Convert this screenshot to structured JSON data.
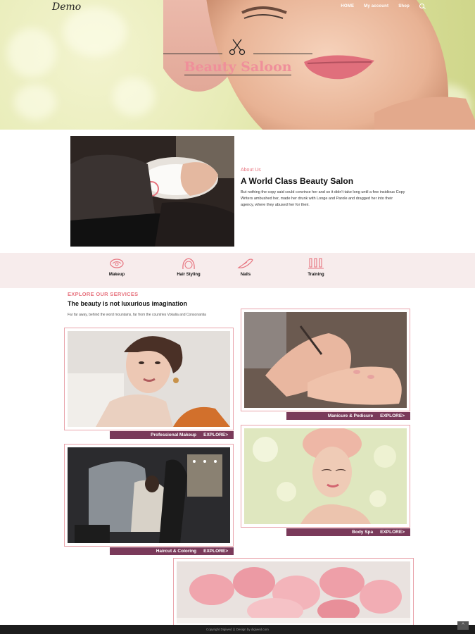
{
  "header": {
    "logo": "Demo",
    "nav": [
      "HOME",
      "My account",
      "Shop"
    ]
  },
  "hero": {
    "title": "Beauty Saloon"
  },
  "about": {
    "kicker": "About Us",
    "title": "A World Class Beauty Salon",
    "body": "But nothing the copy said could convince her and so it didn't take long until a few insidious Copy Writers ambushed her, made her drunk with Longe and Parole and dragged her into their agency, where they abused her for their."
  },
  "features": [
    {
      "label": "Makeup",
      "icon": "makeup-icon"
    },
    {
      "label": "Hair Styling",
      "icon": "hair-styling-icon"
    },
    {
      "label": "Nails",
      "icon": "nails-icon"
    },
    {
      "label": "Training",
      "icon": "training-icon"
    }
  ],
  "services": {
    "kicker": "EXPLORE OUR SERVICES",
    "title": "The beauty is not luxurious imagination",
    "description": "Far far away, behind the word mountains, far from the countries Vokalia and Consonantia",
    "explore_label": "EXPLORE>",
    "cards": [
      {
        "name": "Professional Makeup"
      },
      {
        "name": "Manicure & Pedicure"
      },
      {
        "name": "Haircut & Coloring"
      },
      {
        "name": "Body Spa"
      }
    ]
  },
  "footer": {
    "copyright": "Copyright Digiwed | | Design by digiwed.com",
    "to_top": "^"
  },
  "colors": {
    "accent": "#e7747f",
    "label_bg": "#7a3a5a",
    "band_bg": "#f7ecec",
    "footer_bg": "#1d1d1d"
  }
}
